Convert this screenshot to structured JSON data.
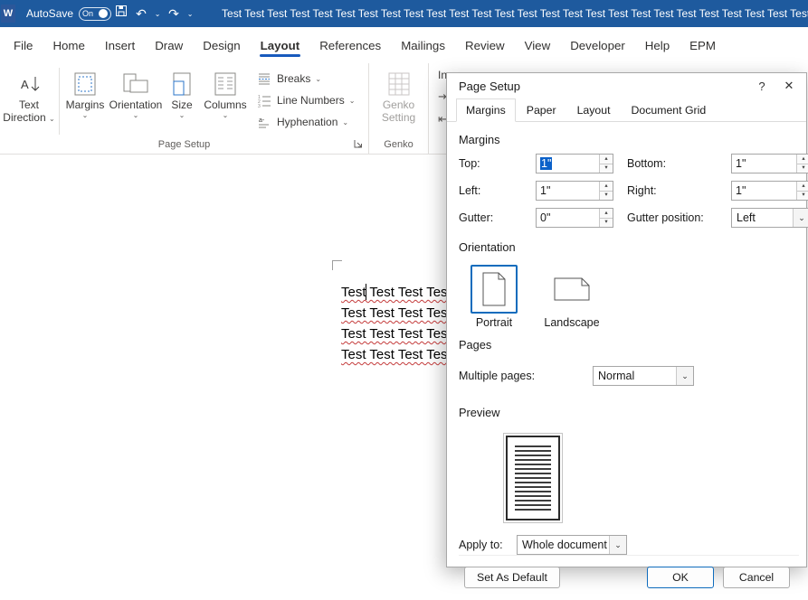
{
  "icons": {
    "chevron": "⌄",
    "spin_up": "▴",
    "spin_down": "▾",
    "undo": "↶",
    "redo": "↷",
    "help": "?",
    "close": "✕",
    "word_logo": "W",
    "indent_left": "⇥",
    "indent_right": "⇤"
  },
  "titlebar": {
    "autosave_label": "AutoSave",
    "autosave_state": "On",
    "title": "Test Test Test Test Test Test Test Test Test Test Test Test Test Test Test Test Test Test Test Test Test Test Test Test Test Test Test Test Test Test"
  },
  "menu": {
    "tabs": [
      "File",
      "Home",
      "Insert",
      "Draw",
      "Design",
      "Layout",
      "References",
      "Mailings",
      "Review",
      "View",
      "Developer",
      "Help",
      "EPM"
    ]
  },
  "ribbon": {
    "text_direction_l1": "Text",
    "text_direction_l2": "Direction",
    "margins": "Margins",
    "orientation": "Orientation",
    "size": "Size",
    "columns": "Columns",
    "breaks": "Breaks",
    "line_numbers": "Line Numbers",
    "hyphenation": "Hyphenation",
    "genko_l1": "Genko",
    "genko_l2": "Setting",
    "group_page_setup": "Page Setup",
    "group_genko": "Genko",
    "indent_partial": "Ind"
  },
  "document": {
    "lines": [
      "Test Test Test Test Test",
      "Test Test Test Test Test",
      "Test Test Test Test Test",
      "Test Test Test Test Test"
    ]
  },
  "dialog": {
    "title": "Page Setup",
    "tabs": [
      "Margins",
      "Paper",
      "Layout",
      "Document Grid"
    ],
    "sections": {
      "margins": "Margins",
      "orientation": "Orientation",
      "pages": "Pages",
      "preview": "Preview"
    },
    "fields": {
      "top_label": "Top:",
      "top_value": "1\"",
      "bottom_label": "Bottom:",
      "bottom_value": "1\"",
      "left_label": "Left:",
      "left_value": "1\"",
      "right_label": "Right:",
      "right_value": "1\"",
      "gutter_label": "Gutter:",
      "gutter_value": "0\"",
      "gutter_pos_label": "Gutter position:",
      "gutter_pos_value": "Left"
    },
    "orientation_options": [
      "Portrait",
      "Landscape"
    ],
    "pages_row": {
      "label": "Multiple pages:",
      "value": "Normal"
    },
    "apply_to": {
      "label": "Apply to:",
      "value": "Whole document"
    },
    "buttons": {
      "default": "Set As Default",
      "ok": "OK",
      "cancel": "Cancel"
    }
  }
}
